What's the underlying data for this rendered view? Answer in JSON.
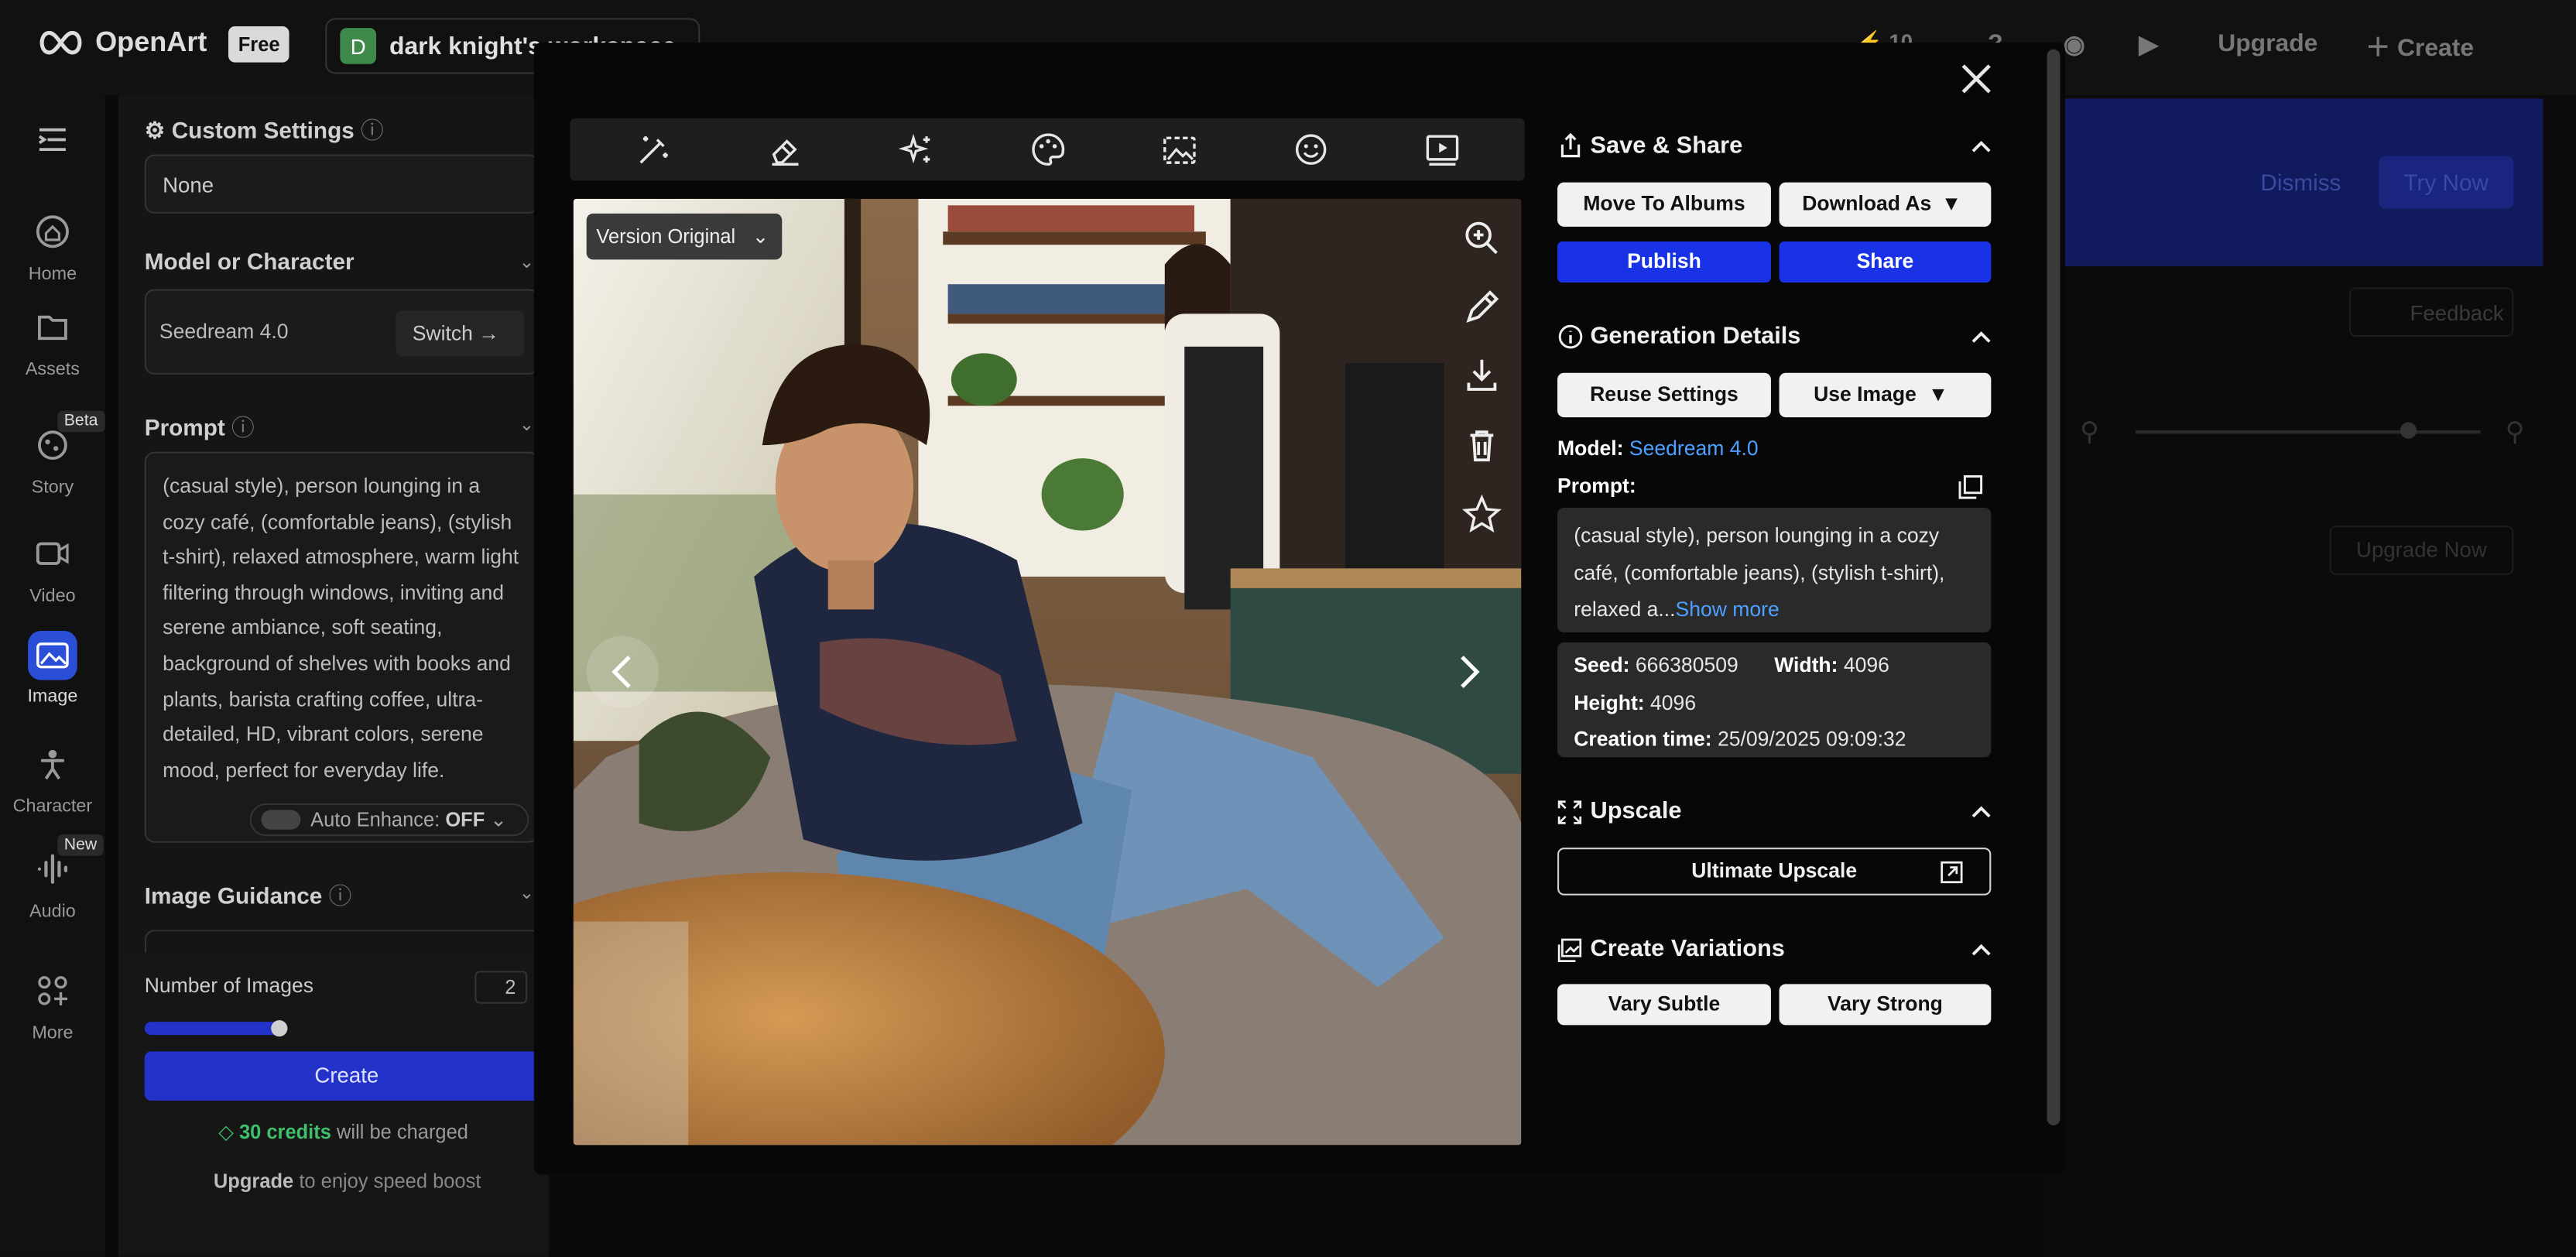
{
  "app": {
    "brand": "OpenArt",
    "plan_badge": "Free",
    "workspace_initial": "D",
    "workspace_name": "dark knight's workspace"
  },
  "topbar": {
    "upgrade_label": "Upgrade",
    "create_label": "Create",
    "credits_value": "10"
  },
  "leftnav": {
    "items": [
      {
        "label": "Home",
        "icon": "home-icon"
      },
      {
        "label": "Assets",
        "icon": "folder-icon"
      },
      {
        "label": "Story",
        "icon": "story-icon",
        "badge": "Beta"
      },
      {
        "label": "Video",
        "icon": "video-icon"
      },
      {
        "label": "Image",
        "icon": "image-icon"
      },
      {
        "label": "Character",
        "icon": "character-icon"
      },
      {
        "label": "Audio",
        "icon": "audio-icon",
        "badge": "New"
      },
      {
        "label": "More",
        "icon": "grid-icon"
      }
    ]
  },
  "settings": {
    "custom_settings_title": "Custom Settings",
    "custom_settings_value": "None",
    "model_title": "Model or Character",
    "model_value": "Seedream 4.0",
    "switch_label": "Switch",
    "prompt_title": "Prompt",
    "prompt_text": "(casual style), person lounging in a cozy café, (comfortable jeans), (stylish t-shirt), relaxed atmosphere, warm light filtering through windows, inviting and serene ambiance, soft seating, background of shelves with books and plants, barista crafting coffee, ultra-detailed, HD, vibrant colors, serene mood, perfect for everyday life.",
    "auto_enhance_label": "Auto Enhance:",
    "auto_enhance_value": "OFF",
    "image_guidance_title": "Image Guidance",
    "num_images_label": "Number of Images",
    "num_images_value": "2",
    "create_label": "Create",
    "credits_amount": "30 credits",
    "credits_suffix": "will be charged",
    "upgrade_link": "Upgrade",
    "upgrade_suffix": "to enjoy speed boost"
  },
  "background": {
    "dismiss_label": "Dismiss",
    "try_now_label": "Try Now",
    "feedback_label": "Feedback",
    "upgrade_now_label": "Upgrade Now"
  },
  "modal": {
    "version_label": "Version Original",
    "save_share_title": "Save & Share",
    "move_to_albums": "Move To Albums",
    "download_as": "Download As",
    "publish": "Publish",
    "share": "Share",
    "generation_details_title": "Generation Details",
    "reuse_settings": "Reuse Settings",
    "use_image": "Use Image",
    "model_label": "Model:",
    "model_value": "Seedream 4.0",
    "prompt_label": "Prompt:",
    "prompt_excerpt": "(casual style), person lounging in a cozy café, (comfortable jeans), (stylish t-shirt), relaxed a...",
    "show_more": "Show more",
    "seed_label": "Seed:",
    "seed_value": "666380509",
    "width_label": "Width:",
    "width_value": "4096",
    "height_label": "Height:",
    "height_value": "4096",
    "creation_label": "Creation time:",
    "creation_value": "25/09/2025 09:09:32",
    "upscale_title": "Upscale",
    "ultimate_upscale": "Ultimate Upscale",
    "variations_title": "Create Variations",
    "vary_subtle": "Vary Subtle",
    "vary_strong": "Vary Strong"
  },
  "colors": {
    "accent_blue": "#1a32e6",
    "link_blue": "#4ea0ff",
    "credits_green": "#3fbf6a"
  }
}
